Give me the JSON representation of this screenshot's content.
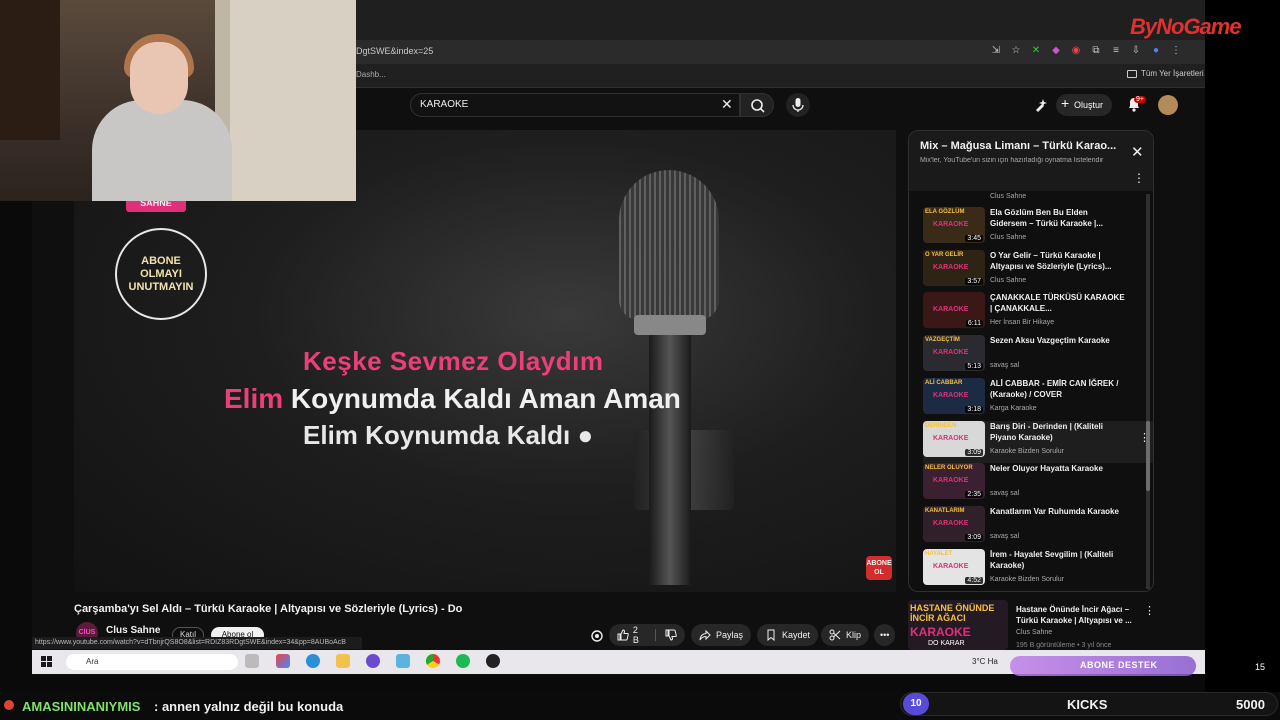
{
  "browser": {
    "url": "DgtSWE&index=25",
    "bookmark_left": "Dashb...",
    "bookmark_right": "Tüm Yer İşaretleri"
  },
  "brand": {
    "text": "ByNoGame"
  },
  "youtube": {
    "search_value": "KARAOKE",
    "create_label": "Oluştur",
    "notif_count": "9+"
  },
  "player": {
    "abone_line1": "ABONE",
    "abone_line2": "OLMAYI",
    "abone_line3": "UNUTMAYIN",
    "pink_tag": "SAHNE",
    "lyric1": "Keşke Sevmez Olaydım",
    "lyric2_hl": "Elim",
    "lyric2_rest": " Koynumda Kaldı Aman Aman",
    "lyric3": "Elim Koynumda Kaldı ●",
    "abone_ol_1": "ABONE",
    "abone_ol_2": "OL"
  },
  "video": {
    "title": "Çarşamba'yı Sel Aldı – Türkü Karaoke | Altyapısı ve Sözleriyle (Lyrics) - Do",
    "channel": "Clus Sahne",
    "channel_avatar": "ClUS",
    "join_label": "Katıl",
    "subscribe_label": "Abone ol",
    "like_count": "2 B",
    "share_label": "Paylaş",
    "save_label": "Kaydet",
    "clip_label": "Klip",
    "status_url": "https://www.youtube.com/watch?v=dTbnjrQS8O8&list=RDIZ83RDgtSWE&index=34&pp=8AUBoAcB"
  },
  "playlist": {
    "title": "Mix – Mağusa Limanı – Türkü Karao...",
    "subtitle": "Mix'ler, YouTube'un sizin için hazırladığı oynatma listeleridir",
    "top_partial_channel": "Clus Sahne",
    "items": [
      {
        "title": "Ela Gözlüm Ben Bu Elden Gidersem – Türkü Karaoke |...",
        "channel": "Clus Sahne",
        "duration": "3:45",
        "thumb_color": "#3a2a18",
        "thumb_text": "ELA GÖZLÜM"
      },
      {
        "title": "O Yar Gelir – Türkü Karaoke | Altyapısı ve Sözleriyle (Lyrics)...",
        "channel": "Clus Sahne",
        "duration": "3:57",
        "thumb_color": "#2e2416",
        "thumb_text": "O YAR GELİR"
      },
      {
        "title": "ÇANAKKALE TÜRKÜSÜ KARAOKE | ÇANAKKALE...",
        "channel": "Her İnsan Bir Hikaye",
        "duration": "6:11",
        "thumb_color": "#3a1818",
        "thumb_text": ""
      },
      {
        "title": "Sezen Aksu Vazgeçtim Karaoke",
        "channel": "savaş sal",
        "duration": "5:13",
        "thumb_color": "#2a2a30",
        "thumb_text": "VAZGEÇTİM"
      },
      {
        "title": "ALİ CABBAR - EMİR CAN İĞREK / (Karaoke) / COVER",
        "channel": "Karga Karaoke",
        "duration": "3:18",
        "thumb_color": "#1c2a44",
        "thumb_text": "ALİ CABBAR"
      },
      {
        "title": "Barış Diri - Derinden | (Kaliteli Piyano Karaoke)",
        "channel": "Karaoke Bizden Sorulur",
        "duration": "3:09",
        "thumb_color": "#d8d8d8",
        "thumb_text": "DERİNDEN"
      },
      {
        "title": "Neler Oluyor Hayatta Karaoke",
        "channel": "savaş sal",
        "duration": "2:35",
        "thumb_color": "#3a2030",
        "thumb_text": "NELER OLUYOR"
      },
      {
        "title": "Kanatlarım Var Ruhumda Karaoke",
        "channel": "savaş sal",
        "duration": "3:09",
        "thumb_color": "#30202a",
        "thumb_text": "KANATLARIM"
      },
      {
        "title": "İrem - Hayalet Sevgilim | (Kaliteli Karaoke)",
        "channel": "Karaoke Bizden Sorulur",
        "duration": "4:52",
        "thumb_color": "#e4e4e4",
        "thumb_text": "HAYALET"
      }
    ]
  },
  "recommended": {
    "title": "Hastane Önünde İncir Ağacı – Türkü Karaoke | Altyapısı ve ...",
    "channel": "Clus Sahne",
    "meta": "195 B görüntüleme • 3 yıl önce",
    "thumb_t1": "HASTANE ÖNÜNDE",
    "thumb_t1b": "İNCİR AĞACI",
    "thumb_t2": "KARAOKE",
    "thumb_t3": "DO KARAR"
  },
  "taskbar": {
    "search_placeholder": "Ara",
    "weather": "3°C Ha",
    "abone_destek": "ABONE DESTEK",
    "count": "15"
  },
  "stream": {
    "chat_user": "AMASININANIYMIS",
    "chat_message": ": annen yalnız değil bu konuda",
    "kicks_count": "10",
    "kicks_label": "KICKS",
    "kicks_value": "5000"
  }
}
